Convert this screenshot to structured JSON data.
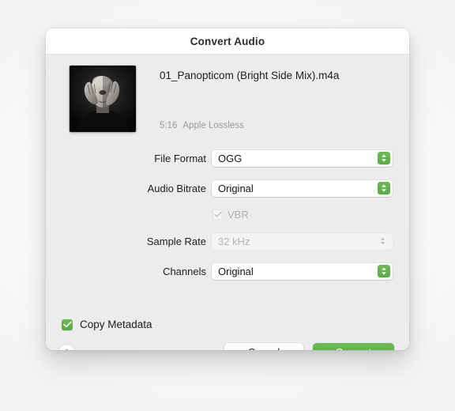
{
  "dialog": {
    "title": "Convert Audio"
  },
  "file": {
    "artwork_alt": "album-artwork",
    "name": "01_Panopticom (Bright Side Mix).m4a",
    "duration": "5:16",
    "format": "Apple Lossless"
  },
  "form": {
    "rows": [
      {
        "label": "File Format",
        "value": "OGG"
      },
      {
        "label": "Audio Bitrate",
        "value": "Original"
      },
      {
        "label": "Sample Rate",
        "value": "32 kHz"
      },
      {
        "label": "Channels",
        "value": "Original"
      }
    ],
    "vbr": {
      "label": "VBR",
      "checked": true,
      "enabled": false
    }
  },
  "options": {
    "copy_metadata_label": "Copy Metadata",
    "copy_metadata_checked": true
  },
  "footer": {
    "help_label": "?",
    "cancel_label": "Cancel",
    "convert_label": "Convert"
  },
  "colors": {
    "accent_green": "#5cad47",
    "window_bg": "#ececec",
    "titlebar_bg": "#fdfdfd",
    "text_primary": "#1d1d1d",
    "text_secondary": "#9b9b9b",
    "text_disabled": "#b4b4b4"
  }
}
